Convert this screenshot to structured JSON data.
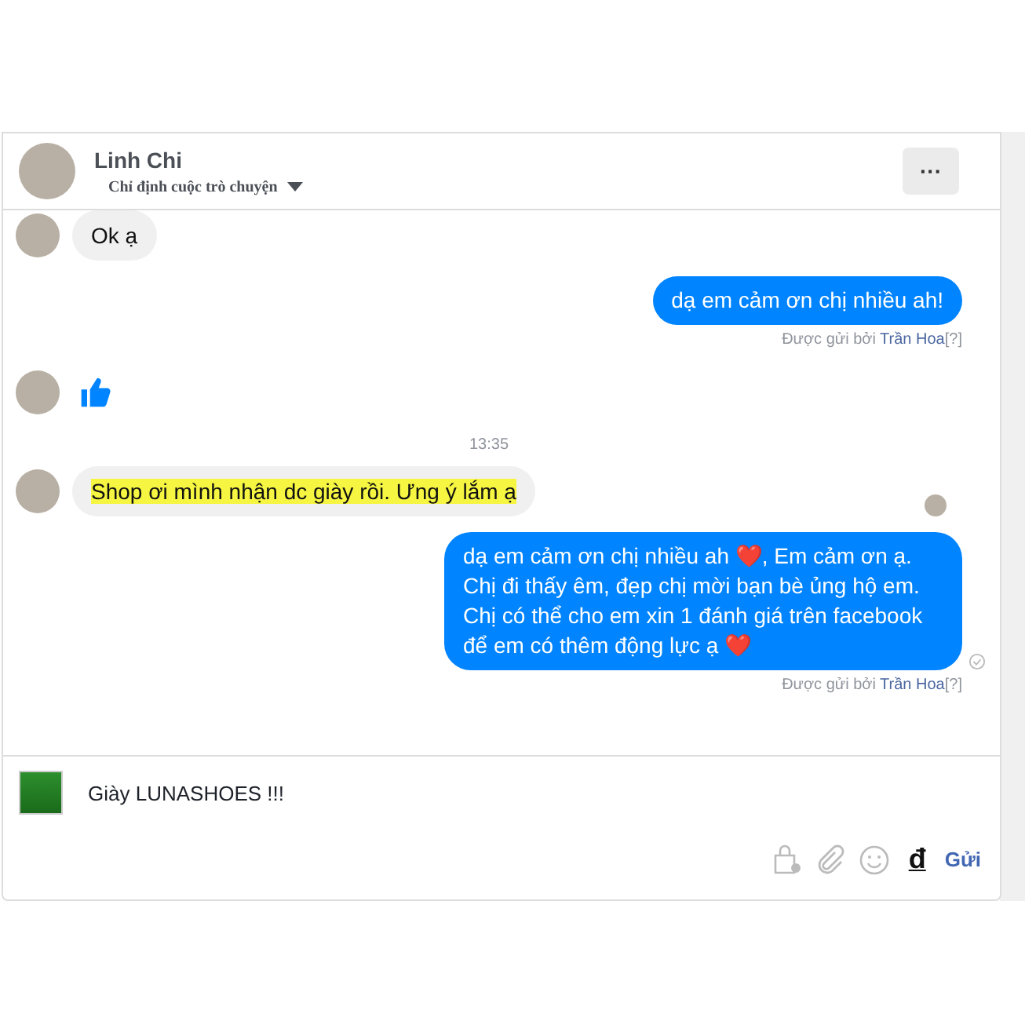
{
  "header": {
    "name": "Linh Chi",
    "subtitle": "Chỉ định cuộc trò chuyện",
    "menu": "···"
  },
  "messages": [
    {
      "kind": "incoming",
      "text": "Ok ạ",
      "highlighted": false,
      "seen_marker": false
    },
    {
      "kind": "outgoing",
      "text": "dạ em cảm ơn chị nhiều ah!",
      "sent_by": "Được gửi bởi",
      "sender": "Trần Hoa",
      "help": "[?]",
      "delivered": false
    },
    {
      "kind": "like"
    },
    {
      "kind": "timestamp",
      "text": "13:35"
    },
    {
      "kind": "incoming",
      "text": "Shop ơi mình nhận dc giày rồi. Ưng ý lắm ạ",
      "highlighted": true,
      "seen_marker": true
    },
    {
      "kind": "outgoing",
      "text": "dạ em cảm ơn chị nhiều ah ❤️, Em cảm ơn ạ. Chị đi thấy êm, đẹp chị mời bạn bè ủng hộ em. Chị có thể cho em xin 1 đánh giá trên facebook để em có thêm động lực ạ ❤️",
      "sent_by": "Được gửi bởi",
      "sender": "Trần Hoa",
      "help": "[?]",
      "delivered": true
    }
  ],
  "composer": {
    "value": "Giày LUNASHOES !!!",
    "currency": "đ",
    "send": "Gửi"
  }
}
